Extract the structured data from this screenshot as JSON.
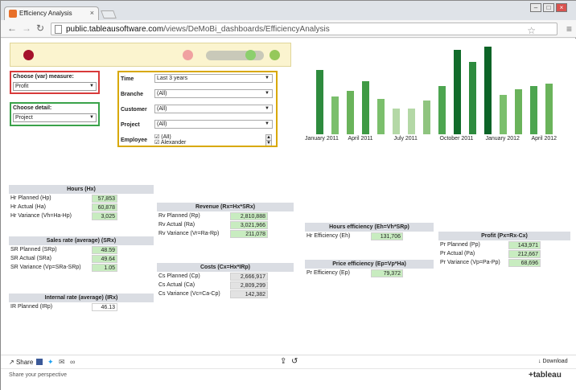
{
  "browser": {
    "tab_title": "Efficiency Analysis",
    "url_host": "public.tableausoftware.com",
    "url_path": "/views/DeMoBi_dashboards/EfficiencyAnalysis"
  },
  "controls": {
    "measure_label": "Choose (var) measure:",
    "measure_value": "Profit",
    "detail_label": "Choose detail:",
    "detail_value": "Project"
  },
  "filters": {
    "time_label": "Time",
    "time_value": "Last 3 years",
    "branche_label": "Branche",
    "branche_value": "(All)",
    "customer_label": "Customer",
    "customer_value": "(All)",
    "project_label": "Project",
    "project_value": "(All)",
    "employee_label": "Employee",
    "employee_opt1": "(All)",
    "employee_opt2": "Alexander"
  },
  "chart_data": {
    "type": "bar",
    "categories": [
      "Jan 2011",
      "Feb 2011",
      "Mar 2011",
      "Apr 2011",
      "May 2011",
      "Jun 2011",
      "Jul 2011",
      "Aug 2011",
      "Sep 2011",
      "Oct 2011",
      "Nov 2011",
      "Dec 2011",
      "Jan 2012",
      "Feb 2012",
      "Mar 2012",
      "Apr 2012"
    ],
    "values": [
      82,
      48,
      55,
      68,
      45,
      33,
      33,
      43,
      62,
      108,
      92,
      112,
      50,
      57,
      62,
      65
    ],
    "colors": [
      "#2e8b3e",
      "#7bbf6c",
      "#6ab35b",
      "#3f9a45",
      "#7bbf6c",
      "#b4d8a6",
      "#b4d8a6",
      "#8fc47f",
      "#4da550",
      "#116b2a",
      "#2e8b3e",
      "#0d6427",
      "#7bbf6c",
      "#6ab35b",
      "#4da550",
      "#6ab35b"
    ],
    "tick_labels": [
      "January 2011",
      "April 2011",
      "July 2011",
      "October 2011",
      "January 2012",
      "April 2012"
    ],
    "ylim": [
      0,
      115
    ]
  },
  "hours": {
    "title": "Hours (Hx)",
    "rows": [
      {
        "k": "Hr Planned (Hp)",
        "v": "57,853"
      },
      {
        "k": "Hr Actual (Ha)",
        "v": "60,878"
      },
      {
        "k": "Hr Variance (Vh=Ha-Hp)",
        "v": "3,025"
      }
    ]
  },
  "sales": {
    "title": "Sales rate (average) (SRx)",
    "rows": [
      {
        "k": "SR Planned (SRp)",
        "v": "48.59"
      },
      {
        "k": "SR Actual (SRa)",
        "v": "49.64"
      },
      {
        "k": "SR Variance (Vp=SRa-SRp)",
        "v": "1.05"
      }
    ]
  },
  "internal": {
    "title": "Internal rate (average) (IRx)",
    "rows": [
      {
        "k": "IR Planned (IRp)",
        "v": "46.13"
      }
    ]
  },
  "revenue": {
    "title": "Revenue (Rx=Hx*SRx)",
    "rows": [
      {
        "k": "Rv Planned (Rp)",
        "v": "2,810,888"
      },
      {
        "k": "Rv Actual (Ra)",
        "v": "3,021,966"
      },
      {
        "k": "Rv Variance (Vr=Ra-Rp)",
        "v": "211,078"
      }
    ]
  },
  "costs": {
    "title": "Costs (Cx=Hx*IRp)",
    "rows": [
      {
        "k": "Cs Planned (Cp)",
        "v": "2,666,917"
      },
      {
        "k": "Cs Actual (Ca)",
        "v": "2,809,299"
      },
      {
        "k": "Cs Variance (Vc=Ca-Cp)",
        "v": "142,382"
      }
    ]
  },
  "hours_eff": {
    "title": "Hours efficiency (Eh=Vh*SRp)",
    "rows": [
      {
        "k": "Hr Efficiency (Eh)",
        "v": "131,706"
      }
    ]
  },
  "price_eff": {
    "title": "Price efficiency (Ep=Vp*Ha)",
    "rows": [
      {
        "k": "Pr Efficiency (Ep)",
        "v": "79,372"
      }
    ]
  },
  "profit": {
    "title": "Profit (Px=Rx-Cx)",
    "rows": [
      {
        "k": "Pr Planned (Pp)",
        "v": "143,971"
      },
      {
        "k": "Pr Actual (Pa)",
        "v": "212,667"
      },
      {
        "k": "Pr Variance (Vp=Pa-Pp)",
        "v": "68,696"
      }
    ]
  },
  "footer": {
    "share": "Share",
    "download": "Download",
    "share_perspective": "Share your perspective",
    "brand": "+tableau"
  }
}
